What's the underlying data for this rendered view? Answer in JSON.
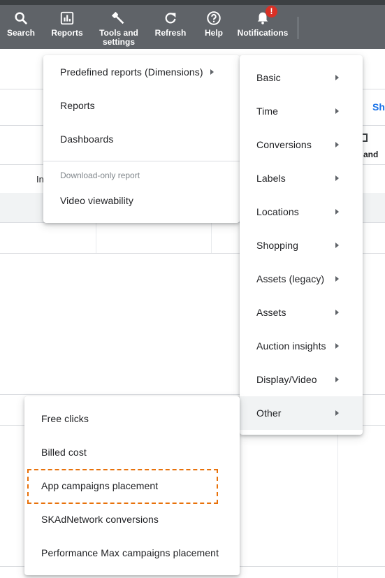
{
  "toolbar": {
    "search": "Search",
    "reports": "Reports",
    "tools_line1": "Tools and",
    "tools_line2": "settings",
    "refresh": "Refresh",
    "help": "Help",
    "notifications": "Notifications",
    "notification_badge": "!"
  },
  "background": {
    "link_partial": "Sho",
    "col_partial_in": "In",
    "col_partial_and": "and"
  },
  "reports_menu": {
    "predefined": "Predefined reports (Dimensions)",
    "reports": "Reports",
    "dashboards": "Dashboards",
    "download_only_header": "Download-only report",
    "video_viewability": "Video viewability"
  },
  "dimensions_menu": {
    "items": [
      "Basic",
      "Time",
      "Conversions",
      "Labels",
      "Locations",
      "Shopping",
      "Assets (legacy)",
      "Assets",
      "Auction insights",
      "Display/Video",
      "Other"
    ]
  },
  "other_menu": {
    "items": [
      "Free clicks",
      "Billed cost",
      "App campaigns placement",
      "SKAdNetwork conversions",
      "Performance Max campaigns placement"
    ]
  },
  "colors": {
    "toolbar": "#5f6368",
    "highlight": "#e8710a",
    "badge": "#d93025",
    "link": "#1a73e8"
  }
}
